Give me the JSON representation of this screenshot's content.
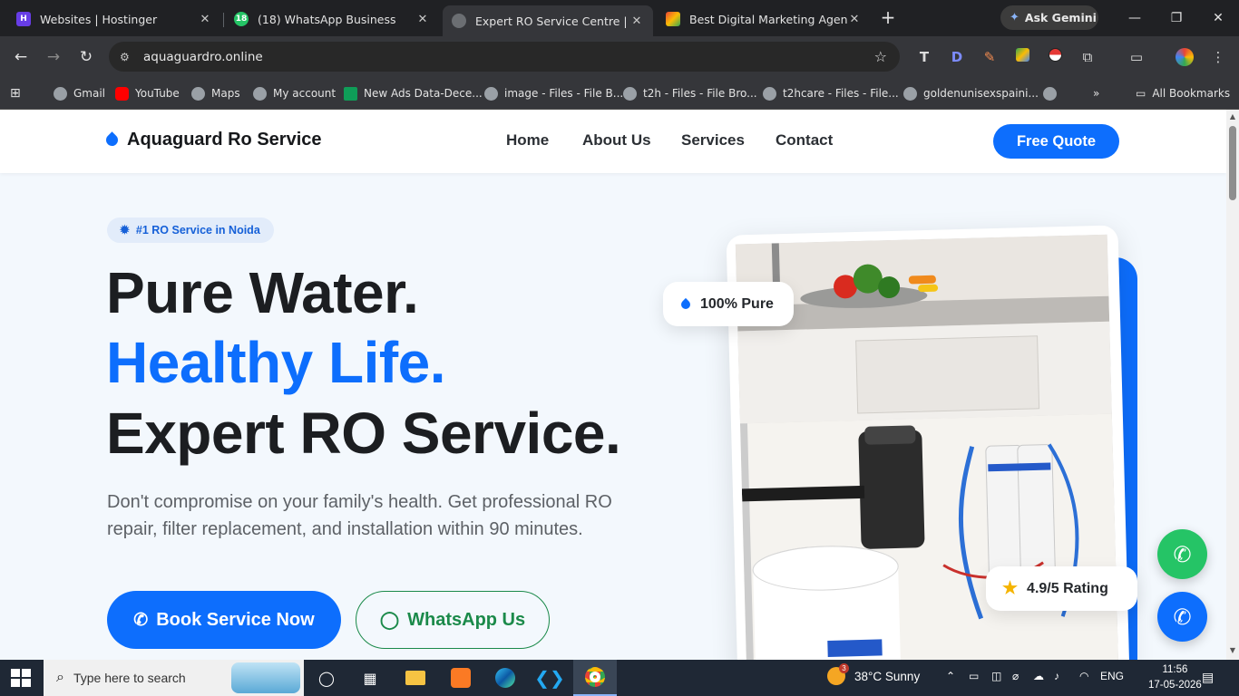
{
  "browser": {
    "tabs": [
      {
        "title": "Websites | Hostinger",
        "favicon": "hostinger-icon",
        "active": false
      },
      {
        "title": "(18) WhatsApp Business",
        "favicon": "whatsapp-icon",
        "badge": "18",
        "active": false
      },
      {
        "title": "Expert RO Service Centre | Aqua",
        "favicon": "globe-icon",
        "active": true
      },
      {
        "title": "Best Digital Marketing Agency",
        "favicon": "agency-icon",
        "active": false
      }
    ],
    "ask_gemini": "Ask Gemini",
    "url": "aquaguardro.online",
    "bookmarks": [
      {
        "label": "Gmail"
      },
      {
        "label": "YouTube"
      },
      {
        "label": "Maps"
      },
      {
        "label": "My account"
      },
      {
        "label": "New Ads Data-Dece..."
      },
      {
        "label": "image - Files - File B..."
      },
      {
        "label": "t2h - Files - File Bro..."
      },
      {
        "label": "t2hcare - Files - File..."
      },
      {
        "label": "goldenunisexspaini..."
      }
    ],
    "all_bookmarks": "All Bookmarks"
  },
  "site": {
    "logo": "Aquaguard Ro Service",
    "nav": [
      "Home",
      "About Us",
      "Services",
      "Contact"
    ],
    "quote_button": "Free Quote",
    "badge": "#1 RO Service in Noida",
    "headline": [
      "Pure Water.",
      "Healthy Life.",
      "Expert RO Service."
    ],
    "lede": "Don't compromise on your family's health. Get professional RO repair, filter replacement, and installation within 90 minutes.",
    "cta_primary": "Book Service Now",
    "cta_secondary": "WhatsApp Us",
    "chip_pure": "100% Pure",
    "chip_rating": "4.9/5 Rating",
    "accent": "#0d6efd",
    "whatsapp_color": "#25c466"
  },
  "taskbar": {
    "search_placeholder": "Type here to search",
    "weather": "38°C  Sunny",
    "weather_badge": "3",
    "lang": "ENG",
    "time": "11:56",
    "date": "17-05-2026"
  }
}
